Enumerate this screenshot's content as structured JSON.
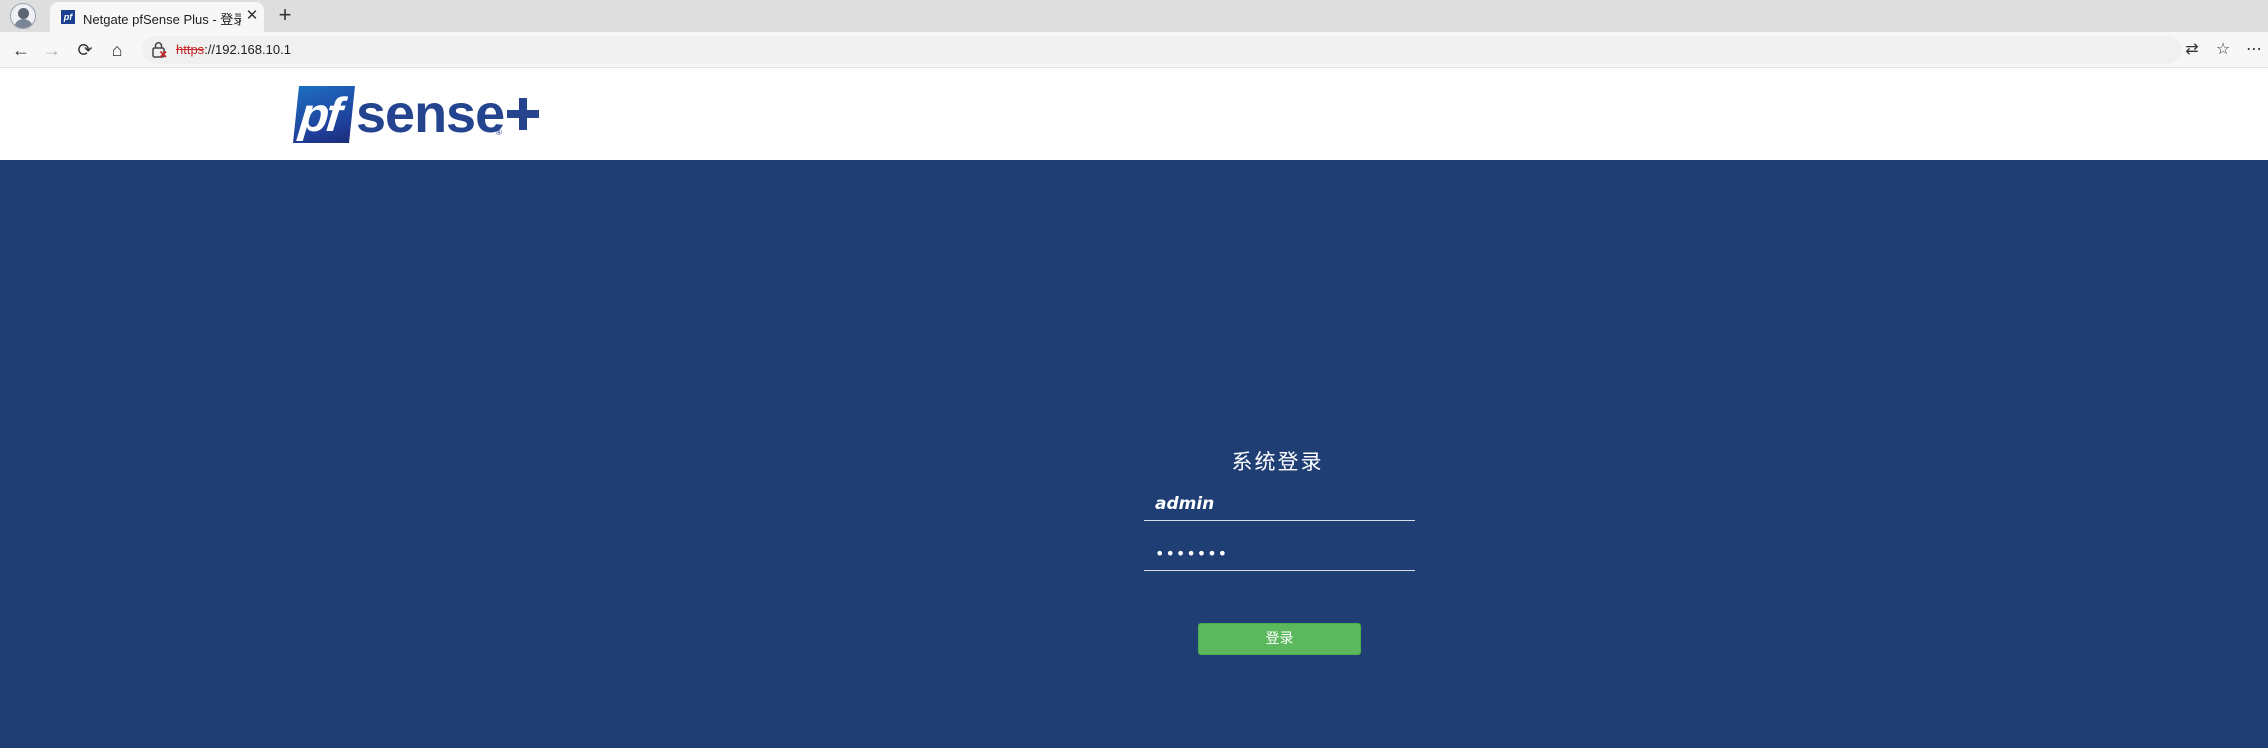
{
  "browser": {
    "tab": {
      "title": "Netgate pfSense Plus - 登录",
      "favicon_text": "pf",
      "close_glyph": "✕"
    },
    "new_tab_glyph": "+",
    "nav": {
      "back_glyph": "←",
      "forward_glyph": "→",
      "reload_glyph": "⟳",
      "home_glyph": "⌂"
    },
    "address_bar": {
      "scheme": "https",
      "rest": "://192.168.10.1",
      "security_state": "not-secure",
      "security_color": "#c62828"
    },
    "right_tools": {
      "translate_glyph": "⇄",
      "favorite_glyph": "☆",
      "more_glyph": "⋯"
    }
  },
  "header": {
    "logo_pf": "pf",
    "logo_sense": "sense",
    "logo_reg": "®",
    "logo_colors": {
      "blue": "#24448f",
      "gradient_start": "#1d6fc2"
    }
  },
  "login": {
    "title": "系统登录",
    "username": {
      "value": "admin"
    },
    "password": {
      "value": "•••••••"
    },
    "submit_label": "登录",
    "button_color": "#5cb85c"
  },
  "colors": {
    "page_background": "#1e3e74",
    "header_background": "#ffffff"
  }
}
